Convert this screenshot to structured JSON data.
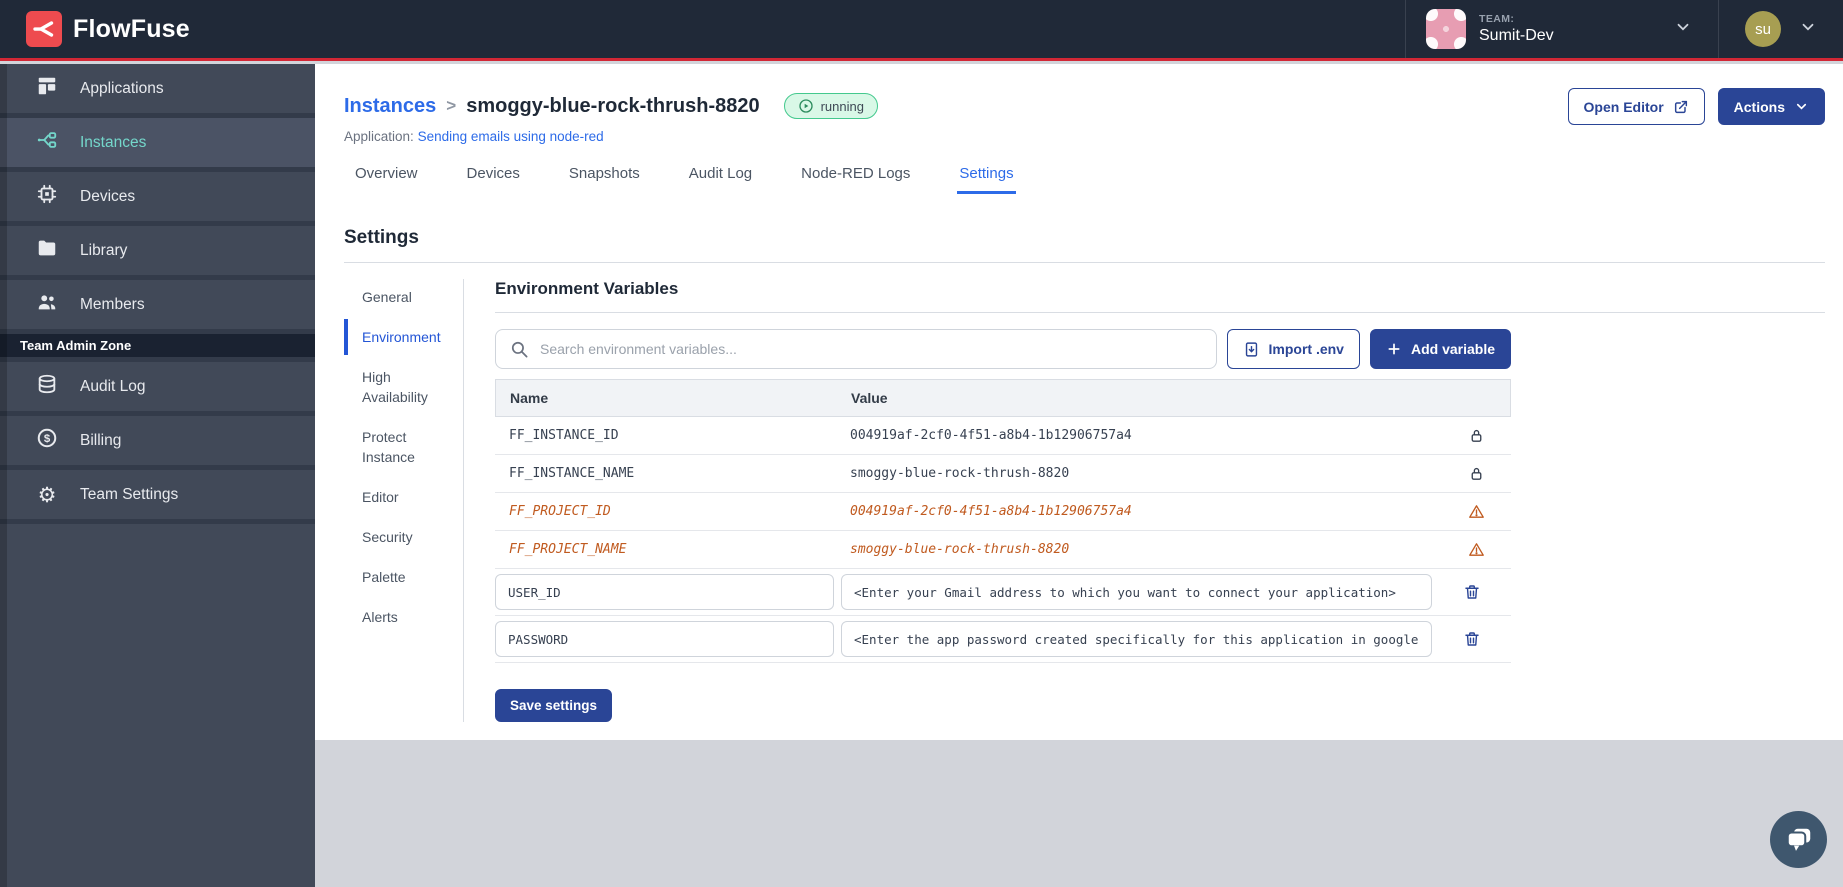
{
  "topbar": {
    "brand": "FlowFuse",
    "team_label": "TEAM:",
    "team_name": "Sumit-Dev",
    "user_initials": "su"
  },
  "sidebar": {
    "items": [
      {
        "label": "Applications"
      },
      {
        "label": "Instances",
        "active": true
      },
      {
        "label": "Devices"
      },
      {
        "label": "Library"
      },
      {
        "label": "Members"
      }
    ],
    "admin_zone_label": "Team Admin Zone",
    "admin_items": [
      {
        "label": "Audit Log"
      },
      {
        "label": "Billing"
      },
      {
        "label": "Team Settings"
      }
    ]
  },
  "header": {
    "breadcrumb_root": "Instances",
    "breadcrumb_separator": ">",
    "instance_name": "smoggy-blue-rock-thrush-8820",
    "status": "running",
    "application_label": "Application:",
    "application_name": "Sending emails using node-red",
    "open_editor_label": "Open Editor",
    "actions_label": "Actions"
  },
  "tabs": {
    "items": [
      "Overview",
      "Devices",
      "Snapshots",
      "Audit Log",
      "Node-RED Logs",
      "Settings"
    ],
    "active": "Settings"
  },
  "settings": {
    "title": "Settings",
    "nav": {
      "items": [
        "General",
        "Environment",
        "High Availability",
        "Protect Instance",
        "Editor",
        "Security",
        "Palette",
        "Alerts"
      ],
      "active": "Environment"
    },
    "section_title": "Environment Variables",
    "search_placeholder": "Search environment variables...",
    "import_label": "Import .env",
    "add_label": "Add variable",
    "save_label": "Save settings",
    "table": {
      "columns": [
        "Name",
        "Value"
      ],
      "rows": [
        {
          "name": "FF_INSTANCE_ID",
          "value": "004919af-2cf0-4f51-a8b4-1b12906757a4",
          "locked": true
        },
        {
          "name": "FF_INSTANCE_NAME",
          "value": "smoggy-blue-rock-thrush-8820",
          "locked": true
        },
        {
          "name": "FF_PROJECT_ID",
          "value": "004919af-2cf0-4f51-a8b4-1b12906757a4",
          "deprecated": true
        },
        {
          "name": "FF_PROJECT_NAME",
          "value": "smoggy-blue-rock-thrush-8820",
          "deprecated": true
        },
        {
          "name": "USER_ID",
          "value": "<Enter your Gmail address to which you want to connect your application>",
          "editable": true
        },
        {
          "name": "PASSWORD",
          "value": "<Enter the app password created specifically for this application in google",
          "editable": true
        }
      ]
    }
  },
  "colors": {
    "brand_red": "#ee4b4f",
    "accent_red_line": "#d22735",
    "navy": "#2a4596",
    "link_blue": "#2d6be8",
    "teal_active": "#74d7cb",
    "deprecated_orange": "#c05a1f",
    "running_border": "#44c98e",
    "running_bg": "#d9f8e7"
  }
}
